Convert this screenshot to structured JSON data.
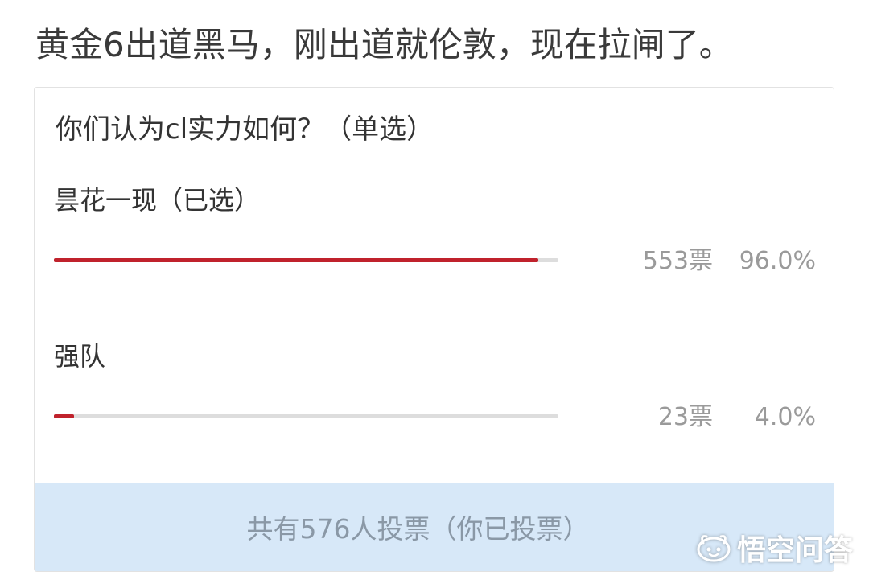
{
  "post": {
    "title": "黄金6出道黑马，刚出道就伦敦，现在拉闸了。"
  },
  "poll": {
    "question": "你们认为cl实力如何？（单选）",
    "accent_color": "#c0222c",
    "track_color": "#dddddd",
    "options": [
      {
        "label": "昙花一现（已选）",
        "votes": "553票",
        "percent": "96.0%",
        "fraction": 0.96,
        "selected": true
      },
      {
        "label": "强队",
        "votes": "23票",
        "percent": "4.0%",
        "fraction": 0.04,
        "selected": false
      }
    ],
    "footer": "共有576人投票（你已投票）",
    "footer_bg": "#d7e8f8"
  },
  "watermark": {
    "icon": "wukong-logo-icon",
    "text": "悟空问答"
  }
}
